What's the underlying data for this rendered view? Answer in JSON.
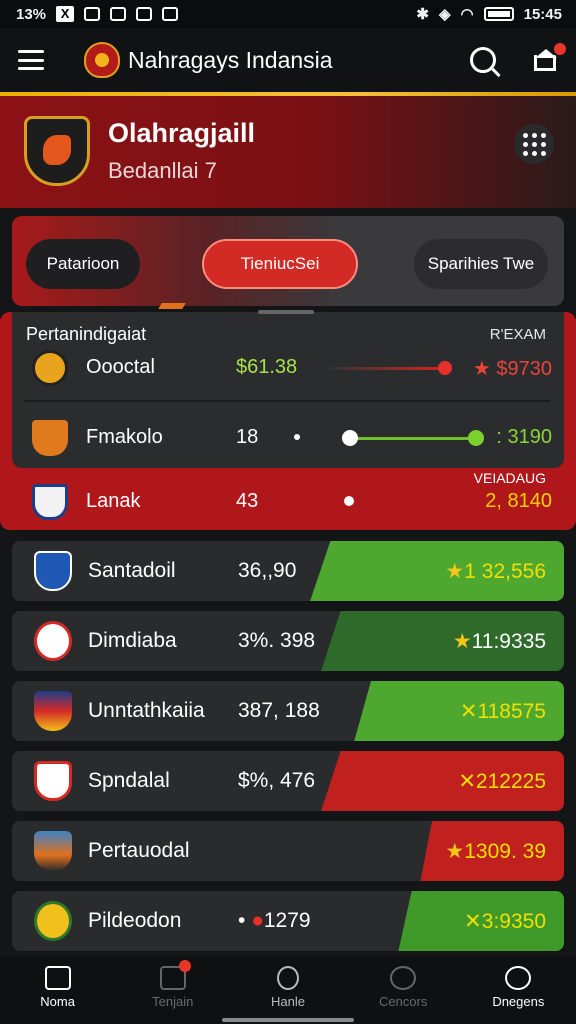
{
  "status_bar": {
    "time_left": "13%",
    "time_right": "15:45"
  },
  "app_bar": {
    "title": "Nahragays Indansia"
  },
  "banner": {
    "title": "Olahragjaill",
    "subtitle": "Bedanllai 7"
  },
  "tabs": [
    {
      "label": "Patarioon",
      "active": false
    },
    {
      "label": "TieniucSei",
      "active": true
    },
    {
      "label": "Sparihies Twe",
      "active": false
    }
  ],
  "table": {
    "header_left": "Pertanindigaiat",
    "header_right": "R'EXAM",
    "rows": [
      {
        "name": "Oooctal",
        "number": "$61.38",
        "value": "★ $9730",
        "value_color": "#e8443a"
      },
      {
        "name": "Fmakolo",
        "number": "18",
        "value": ": 3190",
        "value_color": "#8bd33a"
      },
      {
        "name": "Lanak",
        "number": "43",
        "value": "2, 8140",
        "value_color": "#f2d000",
        "label": "VEIADAUG"
      }
    ]
  },
  "cards": [
    {
      "name": "Santadoil",
      "number": "36,,90",
      "value": "1 32,556",
      "fill_color": "#4ea830",
      "fill_fraction": 0.46
    },
    {
      "name": "Dimdiaba",
      "number": "3%. 398",
      "value": "11:9335",
      "fill_color": "#2e6a2a",
      "fill_fraction": 0.44
    },
    {
      "name": "Unntathkaiia",
      "number": "387, 188",
      "value": "118575",
      "fill_color": "#4ea830",
      "fill_fraction": 0.38
    },
    {
      "name": "Spndalal",
      "number": "$%, 476",
      "value": "212225",
      "fill_color": "#c0201e",
      "fill_fraction": 0.44
    },
    {
      "name": "Pertauodal",
      "number": "",
      "value": "1309. 39",
      "fill_color": "#c0201e",
      "fill_fraction": 0.26
    },
    {
      "name": "Pildeodon",
      "number": "1279",
      "value": "3:9350",
      "fill_color": "#3f9a2a",
      "fill_fraction": 0.3
    }
  ],
  "bottom_nav": [
    {
      "label": "Noma",
      "active": true
    },
    {
      "label": "Tenjain",
      "active": false
    },
    {
      "label": "Hanle",
      "active": false
    },
    {
      "label": "Cencors",
      "active": false
    },
    {
      "label": "Dnegens",
      "active": true
    }
  ]
}
